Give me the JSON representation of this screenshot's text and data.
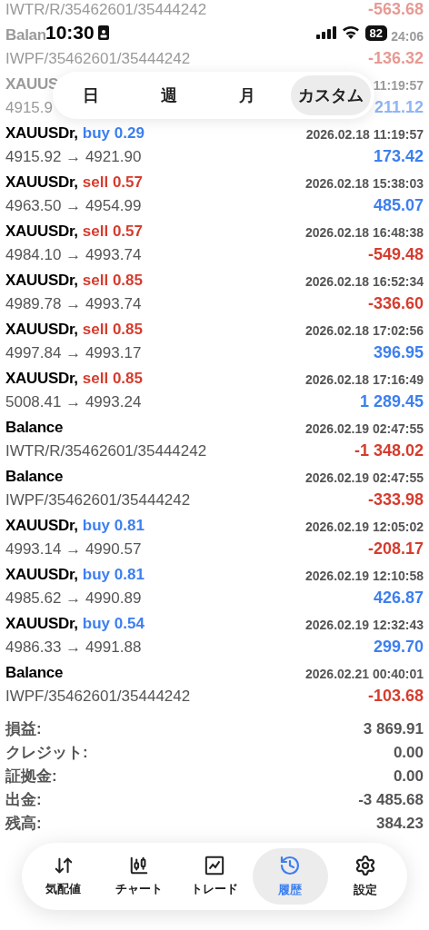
{
  "status_bar": {
    "time": "10:30",
    "battery": "82"
  },
  "faded_rows": [
    {
      "detail": "IWTR/R/35462601/35444242",
      "profit": "-563.68",
      "loss": true
    },
    {
      "title": "Balan",
      "time": "24:06",
      "detail": "IWPF/35462601/35444242",
      "profit": "-136.32",
      "loss": true
    },
    {
      "title": "XAUUS",
      "time": "11:19:57",
      "detail": "4915.9",
      "profit": "211.12",
      "loss": false
    }
  ],
  "period_tabs": [
    {
      "label": "日",
      "selected": false
    },
    {
      "label": "週",
      "selected": false
    },
    {
      "label": "月",
      "selected": false
    },
    {
      "label": "カスタム",
      "selected": true
    }
  ],
  "trades": [
    {
      "kind": "trade",
      "symbol": "XAUUSDr,",
      "sell": false,
      "order": "buy 0.29",
      "time": "2026.02.18 11:19:57",
      "detail": "4915.92 → 4921.90",
      "profit": "173.42",
      "loss": false
    },
    {
      "kind": "trade",
      "symbol": "XAUUSDr,",
      "sell": true,
      "order": "sell 0.57",
      "time": "2026.02.18 15:38:03",
      "detail": "4963.50 → 4954.99",
      "profit": "485.07",
      "loss": false
    },
    {
      "kind": "trade",
      "symbol": "XAUUSDr,",
      "sell": true,
      "order": "sell 0.57",
      "time": "2026.02.18 16:48:38",
      "detail": "4984.10 → 4993.74",
      "profit": "-549.48",
      "loss": true
    },
    {
      "kind": "trade",
      "symbol": "XAUUSDr,",
      "sell": true,
      "order": "sell 0.85",
      "time": "2026.02.18 16:52:34",
      "detail": "4989.78 → 4993.74",
      "profit": "-336.60",
      "loss": true
    },
    {
      "kind": "trade",
      "symbol": "XAUUSDr,",
      "sell": true,
      "order": "sell 0.85",
      "time": "2026.02.18 17:02:56",
      "detail": "4997.84 → 4993.17",
      "profit": "396.95",
      "loss": false
    },
    {
      "kind": "trade",
      "symbol": "XAUUSDr,",
      "sell": true,
      "order": "sell 0.85",
      "time": "2026.02.18 17:16:49",
      "detail": "5008.41 → 4993.24",
      "profit": "1 289.45",
      "loss": false
    },
    {
      "kind": "balance",
      "symbol": "Balance",
      "time": "2026.02.19 02:47:55",
      "detail": "IWTR/R/35462601/35444242",
      "profit": "-1 348.02",
      "loss": true
    },
    {
      "kind": "balance",
      "symbol": "Balance",
      "time": "2026.02.19 02:47:55",
      "detail": "IWPF/35462601/35444242",
      "profit": "-333.98",
      "loss": true
    },
    {
      "kind": "trade",
      "symbol": "XAUUSDr,",
      "sell": false,
      "order": "buy 0.81",
      "time": "2026.02.19 12:05:02",
      "detail": "4993.14 → 4990.57",
      "profit": "-208.17",
      "loss": true
    },
    {
      "kind": "trade",
      "symbol": "XAUUSDr,",
      "sell": false,
      "order": "buy 0.81",
      "time": "2026.02.19 12:10:58",
      "detail": "4985.62 → 4990.89",
      "profit": "426.87",
      "loss": false
    },
    {
      "kind": "trade",
      "symbol": "XAUUSDr,",
      "sell": false,
      "order": "buy 0.54",
      "time": "2026.02.19 12:32:43",
      "detail": "4986.33 → 4991.88",
      "profit": "299.70",
      "loss": false
    },
    {
      "kind": "balance",
      "symbol": "Balance",
      "time": "2026.02.21 00:40:01",
      "detail": "IWPF/35462601/35444242",
      "profit": "-103.68",
      "loss": true
    }
  ],
  "summary": [
    {
      "label": "損益:",
      "value": "3 869.91"
    },
    {
      "label": "クレジット:",
      "value": "0.00"
    },
    {
      "label": "証拠金:",
      "value": "0.00"
    },
    {
      "label": "出金:",
      "value": "-3 485.68"
    },
    {
      "label": "残高:",
      "value": "384.23"
    }
  ],
  "nav": [
    {
      "kind": "quotes",
      "label": "気配値",
      "selected": false
    },
    {
      "kind": "chart",
      "label": "チャート",
      "selected": false
    },
    {
      "kind": "trade",
      "label": "トレード",
      "selected": false
    },
    {
      "kind": "history",
      "label": "履歴",
      "selected": true
    },
    {
      "kind": "settings",
      "label": "設定",
      "selected": false
    }
  ]
}
